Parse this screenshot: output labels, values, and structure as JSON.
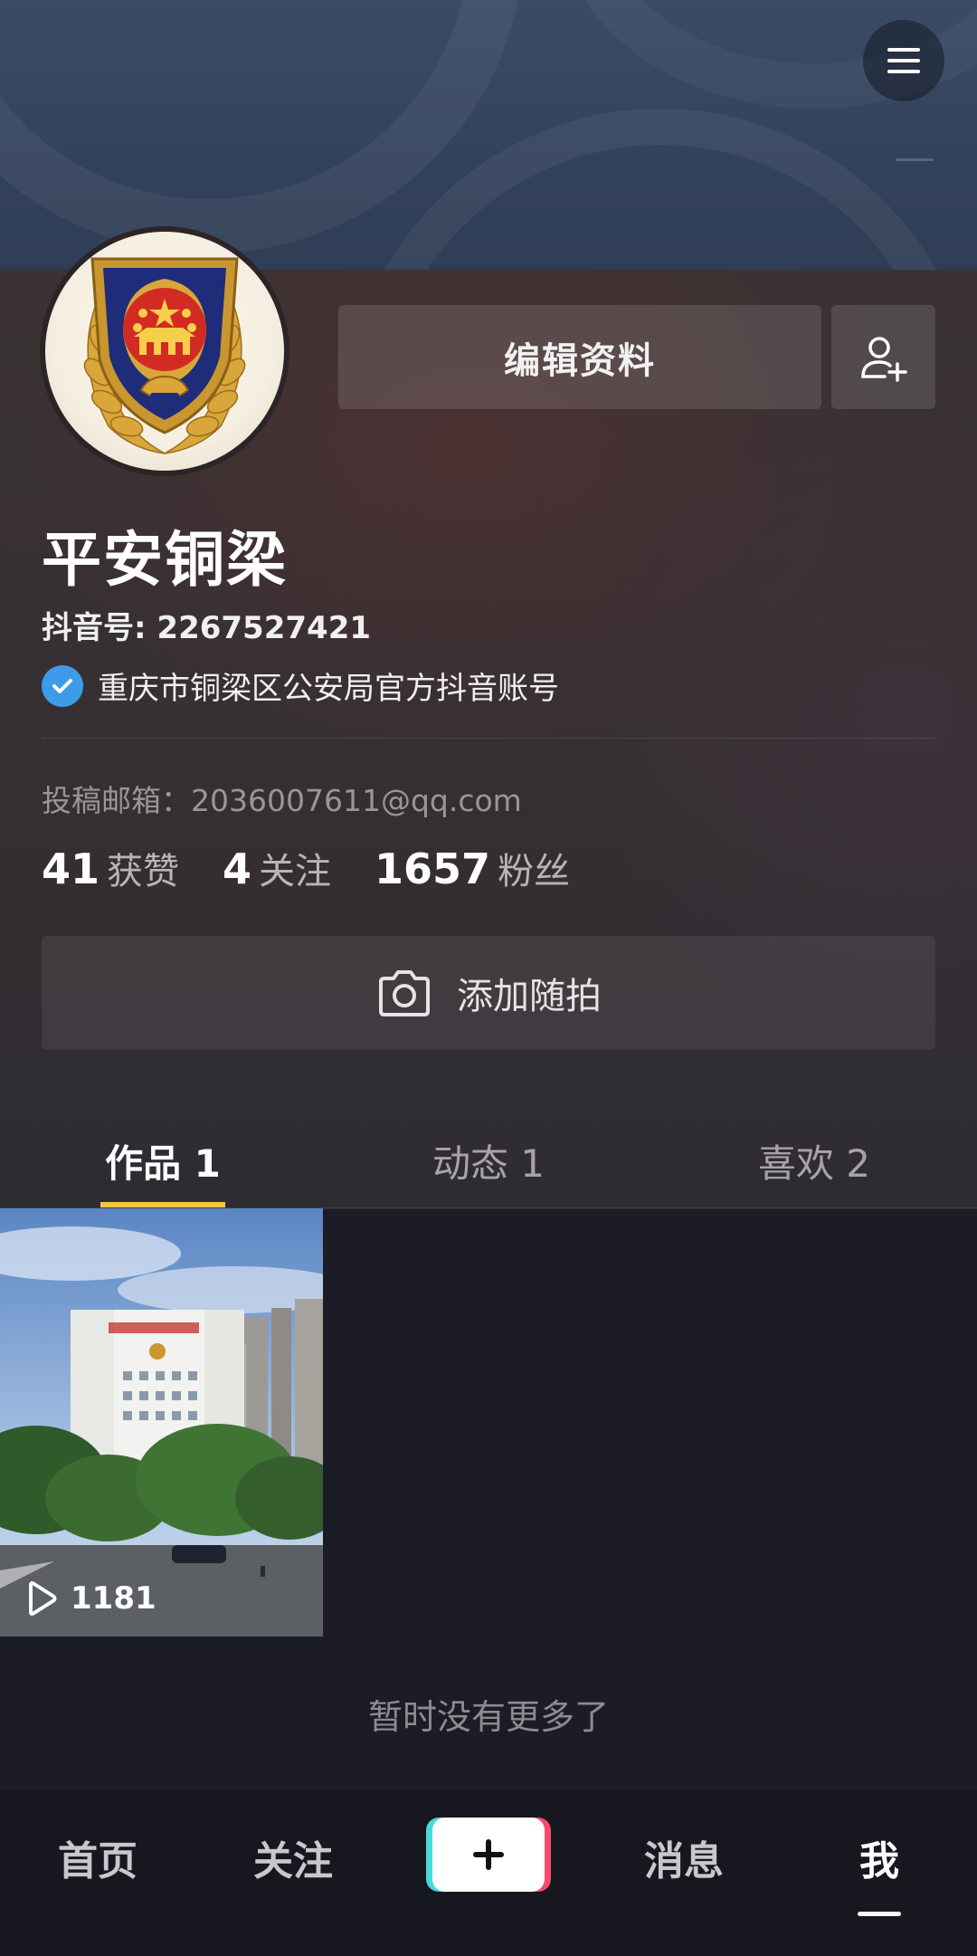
{
  "header": {
    "menu_icon": "hamburger-menu-icon"
  },
  "profile": {
    "edit_label": "编辑资料",
    "add_friend_icon": "add-user-icon",
    "name": "平安铜梁",
    "douyin_id": "抖音号: 2267527421",
    "verified_text": "重庆市铜梁区公安局官方抖音账号",
    "email": "投稿邮箱：2036007611@qq.com",
    "stats": [
      {
        "num": "41",
        "label": "获赞"
      },
      {
        "num": "4",
        "label": "关注"
      },
      {
        "num": "1657",
        "label": "粉丝"
      }
    ],
    "add_shot_label": "添加随拍"
  },
  "tabs": [
    {
      "label": "作品 1",
      "active": true
    },
    {
      "label": "动态 1",
      "active": false
    },
    {
      "label": "喜欢 2",
      "active": false
    }
  ],
  "videos": [
    {
      "play_count": "1181"
    }
  ],
  "footer_note": "暂时没有更多了",
  "bottom_nav": {
    "home": "首页",
    "follow": "关注",
    "messages": "消息",
    "me": "我"
  },
  "colors": {
    "accent": "#f7c53c",
    "verified": "#3d9be9",
    "create_left": "#49d8dc",
    "create_right": "#f54a6a"
  }
}
